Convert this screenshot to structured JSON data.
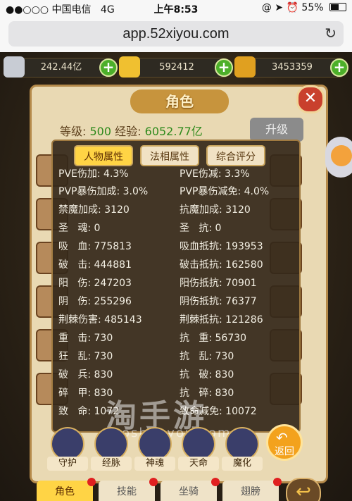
{
  "status": {
    "signal": "●●○○○",
    "carrier": "中国电信",
    "network": "4G",
    "time": "上午8:53",
    "right_icons": "@ ➤ ⏰",
    "battery": "55%"
  },
  "browser": {
    "url": "app.52xiyou.com"
  },
  "currencies": [
    {
      "value": "242.44亿"
    },
    {
      "value": "592412"
    },
    {
      "value": "3453359"
    }
  ],
  "panel": {
    "title": "角色",
    "level_label": "等级:",
    "level_value": "500",
    "exp_label": "经验:",
    "exp_value": "6052.77亿",
    "upgrade": "升级"
  },
  "overlay": {
    "tabs": [
      "人物属性",
      "法相属性",
      "综合评分"
    ],
    "rows": [
      {
        "l": "PVE伤加: 4.3%",
        "r": "PVE伤减: 3.3%"
      },
      {
        "l": "PVP暴伤加成: 3.0%",
        "r": "PVP暴伤减免: 4.0%"
      },
      {
        "l": "禁魔加成: 3120",
        "r": "抗魔加成: 3120"
      },
      {
        "l": "圣   魂: 0",
        "r": "圣   抗: 0"
      },
      {
        "l": "吸   血: 775813",
        "r": "吸血抵抗: 193953"
      },
      {
        "l": "破   击: 444881",
        "r": "破击抵抗: 162580"
      },
      {
        "l": "阳   伤: 247203",
        "r": "阳伤抵抗: 70901"
      },
      {
        "l": "阴   伤: 255296",
        "r": "阴伤抵抗: 76377"
      },
      {
        "l": "荆棘伤害: 485143",
        "r": "荆棘抵抗: 121286"
      },
      {
        "l": "重   击: 730",
        "r": "抗   重: 56730"
      },
      {
        "l": "狂   乱: 730",
        "r": "抗   乱: 730"
      },
      {
        "l": "破   兵: 830",
        "r": "抗   破: 830"
      },
      {
        "l": "碎   甲: 830",
        "r": "抗   碎: 830"
      },
      {
        "l": "致   命: 1072",
        "r": "致命减免: 10072"
      }
    ]
  },
  "bottom_icons": [
    "守护",
    "经脉",
    "神魂",
    "天命",
    "魔化"
  ],
  "back_label": "返回",
  "bottom_tabs": [
    "角色",
    "技能",
    "坐骑",
    "翅膀"
  ],
  "watermark": {
    "cn": "淘手游",
    "en": "Taoshouyou.com"
  }
}
